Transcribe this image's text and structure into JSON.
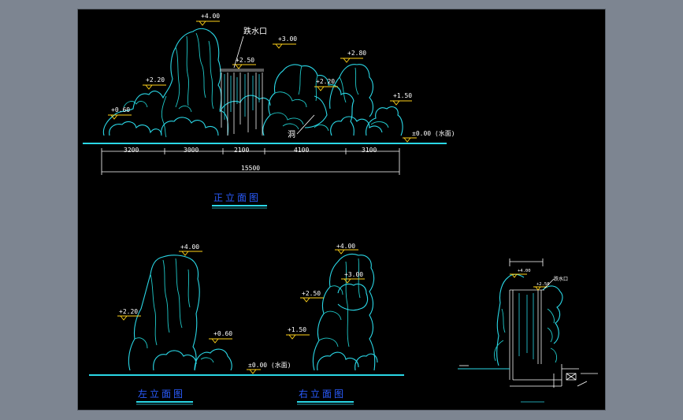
{
  "drawing": {
    "front_elevation": {
      "title": "正立面图",
      "levels": [
        "+4.00",
        "+3.00",
        "+2.80",
        "+2.50",
        "+2.20",
        "+2.20",
        "+1.50",
        "+0.60"
      ],
      "water_level": "±0.00 (水面)",
      "labels": {
        "waterfall_outlet": "跌水口",
        "cave": "洞"
      },
      "dimensions": [
        "3200",
        "3000",
        "2100",
        "4100",
        "3100"
      ],
      "total_dimension": "15500"
    },
    "left_elevation": {
      "title": "左立面图",
      "levels": [
        "+4.00",
        "+2.20",
        "+0.60"
      ]
    },
    "right_elevation": {
      "title": "右立面图",
      "levels": [
        "+4.00",
        "+3.00",
        "+2.50",
        "+1.50"
      ],
      "water_level": "±0.00 (水面)"
    },
    "section": {
      "levels": [
        "+4.00",
        "+2.50"
      ],
      "labels": {
        "waterfall_outlet": "跌水口"
      }
    }
  }
}
